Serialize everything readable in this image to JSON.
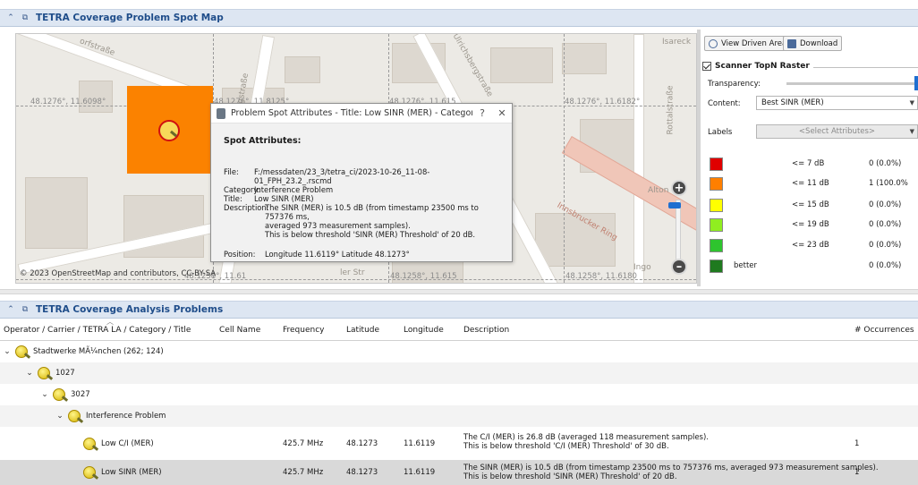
{
  "map_panel": {
    "title": "TETRA Coverage Problem Spot Map",
    "attribution": "© 2023 OpenStreetMap and contributors, CC-BY-SA",
    "coords": {
      "left_top": "48.1276°, 11.6098°",
      "mid_top": "48.1276°, 11.8125°",
      "right_mid": "48.1276°, 11.615",
      "far_right": "48.1276°, 11.6182°",
      "bottom_left": "48.1258°, 11.61",
      "bottom_mid": "48.1258°, 11.615",
      "bottom_right": "48.1258°, 11.6180"
    },
    "streets": {
      "s1": "orfstraße",
      "s2": "Ingstraße",
      "s3": "Ulrichsbergstraße",
      "s4": "Isareck",
      "s5": "Rottalstraße",
      "s6": "Innsbrucker Ring",
      "s7": "Alton",
      "s8": "Ingo",
      "s9": "ler Str"
    },
    "zoom_in": "+",
    "zoom_out": "–"
  },
  "dialog": {
    "title": "Problem Spot Attributes - Title: Low SINR (MER) - Categor...",
    "help": "?",
    "close": "✕",
    "heading": "Spot Attributes:",
    "fields": {
      "file_label": "File:",
      "file": "F:/messdaten/23_3/tetra_ci/2023-10-26_11-08-01_FPH_23.2_.rscmd",
      "category_label": "Category:",
      "category": "Interference Problem",
      "title_label": "Title:",
      "title": "Low SINR (MER)",
      "description_label": "Description:",
      "description_1": "The SINR (MER) is 10.5 dB (from timestamp 23500 ms to 757376 ms,",
      "description_2": "averaged 973 measurement samples).",
      "description_3": "This is below threshold 'SINR (MER) Threshold' of 20 dB.",
      "position_label": "Position:",
      "position": "Longitude 11.6119° Latitude 48.1273°"
    }
  },
  "controls": {
    "view_driven_area": "View Driven Area",
    "download": "Download",
    "scanner_title": "Scanner TopN Raster",
    "transparency_label": "Transparency:",
    "content_label": "Content:",
    "content_value": "Best SINR (MER)",
    "labels_label": "Labels",
    "labels_placeholder": "<Select Attributes>",
    "legend": [
      {
        "color": "#e00000",
        "threshold": "<= 7 dB",
        "count": "0 (0.0%)"
      },
      {
        "color": "#ff7f00",
        "threshold": "<= 11 dB",
        "count": "1 (100.0%"
      },
      {
        "color": "#ffff00",
        "threshold": "<= 15 dB",
        "count": "0 (0.0%)"
      },
      {
        "color": "#90ee20",
        "threshold": "<= 19 dB",
        "count": "0 (0.0%)"
      },
      {
        "color": "#2ec42e",
        "threshold": "<= 23 dB",
        "count": "0 (0.0%)"
      },
      {
        "color": "#1f7a1f",
        "threshold": "better",
        "count": "0 (0.0%)"
      }
    ]
  },
  "problems_panel": {
    "title": "TETRA Coverage Analysis Problems",
    "columns": {
      "tree": "Operator / Carrier / TETRA LA / Category / Title",
      "cell_name": "Cell Name",
      "frequency": "Frequency",
      "latitude": "Latitude",
      "longitude": "Longitude",
      "description": "Description",
      "occurrences": "# Occurrences"
    },
    "tree": {
      "operator": "Stadtwerke MÃ¼nchen (262; 124)",
      "carrier": "1027",
      "la": "3027",
      "category": "Interference Problem"
    },
    "rows": [
      {
        "title": "Low C/I (MER)",
        "frequency": "425.7 MHz",
        "latitude": "48.1273",
        "longitude": "11.6119",
        "desc_1": "The C/I (MER) is 26.8 dB (averaged 118 measurement samples).",
        "desc_2": "This is below threshold 'C/I (MER) Threshold' of 30 dB.",
        "occurrences": "1"
      },
      {
        "title": "Low SINR (MER)",
        "frequency": "425.7 MHz",
        "latitude": "48.1273",
        "longitude": "11.6119",
        "desc_1": "The SINR (MER) is 10.5 dB (from timestamp 23500 ms to 757376 ms, averaged 973 measurement samples).",
        "desc_2": "This is below threshold 'SINR (MER) Threshold' of 20 dB.",
        "occurrences": "1"
      }
    ]
  }
}
